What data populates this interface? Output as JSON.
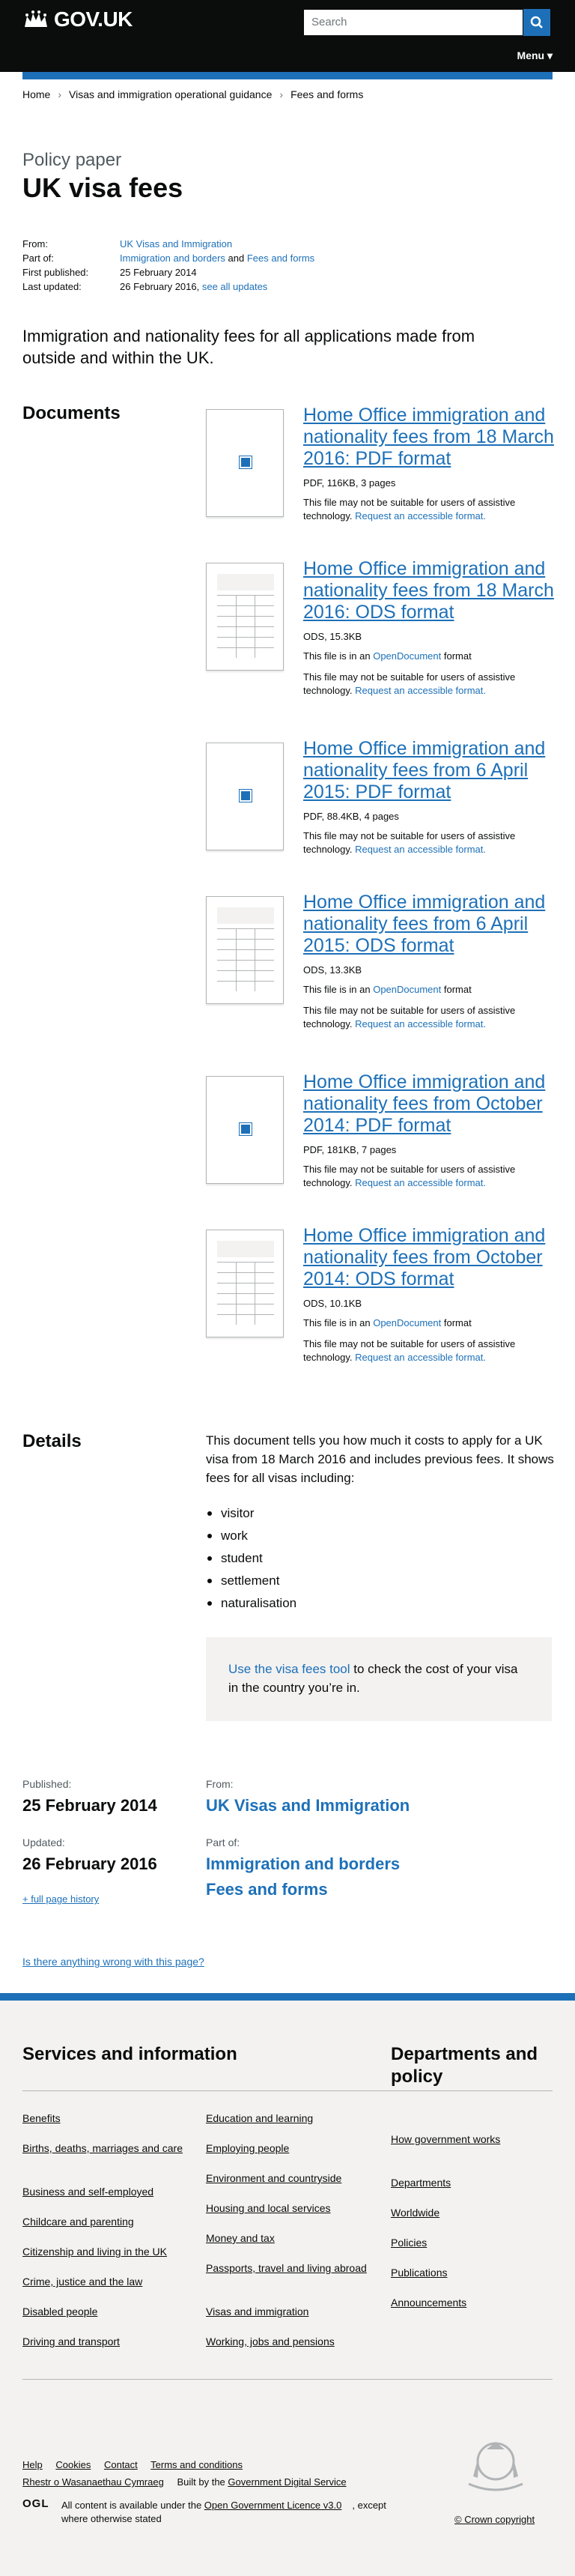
{
  "header": {
    "logo_text": "GOV.UK",
    "search_placeholder": "Search",
    "menu_label": "Menu ▾"
  },
  "breadcrumb": [
    "Home",
    "Visas and immigration operational guidance",
    "Fees and forms"
  ],
  "page": {
    "doc_type": "Policy paper",
    "title": "UK visa fees",
    "summary": "Immigration and nationality fees for all applications made from outside and within the UK."
  },
  "meta": {
    "from_label": "From:",
    "from_value": "UK Visas and Immigration",
    "part_of_label": "Part of:",
    "part_of_1": "Immigration and borders",
    "part_of_and": " and ",
    "part_of_2": "Fees and forms",
    "first_published_label": "First published:",
    "first_published_value": "25 February 2014",
    "last_updated_label": "Last updated:",
    "last_updated_value": "26 February 2016, ",
    "see_all_updates": "see all updates"
  },
  "documents": {
    "heading": "Documents",
    "items": [
      {
        "title": "Home Office immigration and nationality fees from 18 March 2016: PDF format",
        "meta": "PDF, 116KB, 3 pages",
        "kind": "pdf",
        "open_note": "",
        "open_link": "",
        "open_after": "",
        "note": "This file may not be suitable for users of assistive technology. ",
        "request": "Request an accessible format."
      },
      {
        "title": "Home Office immigration and nationality fees from 18 March 2016: ODS format",
        "meta": "ODS, 15.3KB",
        "kind": "ods",
        "open_note": "This file is in an ",
        "open_link": "OpenDocument",
        "open_after": " format",
        "note": "This file may not be suitable for users of assistive technology. ",
        "request": "Request an accessible format."
      },
      {
        "title": "Home Office immigration and nationality fees from 6 April 2015: PDF format",
        "meta": "PDF, 88.4KB, 4 pages",
        "kind": "pdf",
        "open_note": "",
        "open_link": "",
        "open_after": "",
        "note": "This file may not be suitable for users of assistive technology. ",
        "request": "Request an accessible format."
      },
      {
        "title": "Home Office immigration and nationality fees from 6 April 2015: ODS format",
        "meta": "ODS, 13.3KB",
        "kind": "ods",
        "open_note": "This file is in an ",
        "open_link": "OpenDocument",
        "open_after": " format",
        "note": "This file may not be suitable for users of assistive technology. ",
        "request": "Request an accessible format."
      },
      {
        "title": "Home Office immigration and nationality fees from October 2014: PDF format",
        "meta": "PDF, 181KB, 7 pages",
        "kind": "pdf",
        "open_note": "",
        "open_link": "",
        "open_after": "",
        "note": "This file may not be suitable for users of assistive technology. ",
        "request": "Request an accessible format."
      },
      {
        "title": "Home Office immigration and nationality fees from October 2014: ODS format",
        "meta": "ODS, 10.1KB",
        "kind": "ods",
        "open_note": "This file is in an ",
        "open_link": "OpenDocument",
        "open_after": " format",
        "note": "This file may not be suitable for users of assistive technology. ",
        "request": "Request an accessible format."
      }
    ]
  },
  "details": {
    "heading": "Details",
    "text": "This document tells you how much it costs to apply for a UK visa from 18 March 2016 and includes previous fees. It shows fees for all visas including:",
    "list": [
      "visitor",
      "work",
      "student",
      "settlement",
      "naturalisation"
    ],
    "callout_link": "Use the visa fees tool",
    "callout_text": " to check the cost of your visa in the country you’re in."
  },
  "publication": {
    "published_label": "Published:",
    "published_value": "25 February 2014",
    "updated_label": "Updated:",
    "updated_value": "26 February 2016",
    "full_history": "+ full page history",
    "from_label": "From:",
    "from_value": "UK Visas and Immigration",
    "part_of_label": "Part of:",
    "part_of_1": "Immigration and borders",
    "part_of_2": "Fees and forms"
  },
  "report_link": "Is there anything wrong with this page?",
  "footer": {
    "services_heading": "Services and information",
    "services_col1": [
      "Benefits",
      "Births, deaths, marriages and care",
      "Business and self-employed",
      "Childcare and parenting",
      "Citizenship and living in the UK",
      "Crime, justice and the law",
      "Disabled people",
      "Driving and transport"
    ],
    "services_col2": [
      "Education and learning",
      "Employing people",
      "Environment and countryside",
      "Housing and local services",
      "Money and tax",
      "Passports, travel and living abroad",
      "Visas and immigration",
      "Working, jobs and pensions"
    ],
    "departments_heading": "Departments and policy",
    "departments": [
      "How government works",
      "Departments",
      "Worldwide",
      "Policies",
      "Publications",
      "Announcements"
    ],
    "support_links": [
      "Help",
      "Cookies",
      "Contact",
      "Terms and conditions"
    ],
    "welsh": "Rhestr o Wasanaethau Cymraeg",
    "built_by_prefix": "Built by the ",
    "built_by_link": "Government Digital Service",
    "ogl_logo": "OGL",
    "licence_prefix": "All content is available under the ",
    "licence_link": "Open Government Licence v3.0",
    "licence_suffix": ", except where otherwise stated",
    "copyright": "© Crown copyright"
  },
  "colors": {
    "link": "#1d70b8",
    "header": "#0b0c0c",
    "footer_bg": "#f3f2f1",
    "callout_bg": "#f3f2f1"
  }
}
